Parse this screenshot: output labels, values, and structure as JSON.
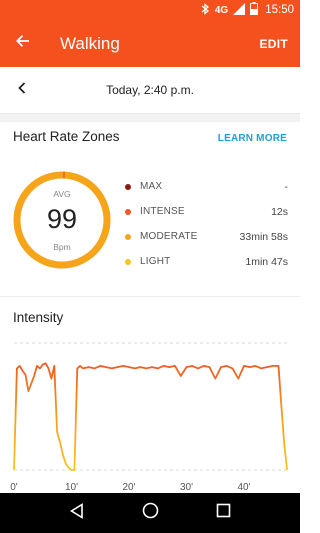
{
  "status": {
    "network": "4G",
    "time": "15:50",
    "icons": [
      "bluetooth-icon",
      "signal-icon",
      "battery-icon"
    ]
  },
  "app_bar": {
    "title": "Walking",
    "edit_label": "EDIT",
    "back_icon": "arrow-left-icon",
    "color": "#f4511e"
  },
  "date_bar": {
    "date": "Today, 2:40 p.m.",
    "prev_icon": "chevron-left-icon"
  },
  "heart_rate": {
    "title": "Heart Rate Zones",
    "learn_more": "LEARN MORE",
    "avg_label": "AVG",
    "avg_value": "99",
    "unit": "Bpm",
    "zones": [
      {
        "name": "MAX",
        "value": "-",
        "color": "#8b1a10"
      },
      {
        "name": "INTENSE",
        "value": "12s",
        "color": "#f05a24"
      },
      {
        "name": "MODERATE",
        "value": "33min 58s",
        "color": "#f6a51b"
      },
      {
        "name": "LIGHT",
        "value": "1min 47s",
        "color": "#f8c41f"
      }
    ]
  },
  "intensity": {
    "title": "Intensity"
  },
  "chart_data": {
    "type": "area",
    "title": "Intensity",
    "x_ticks": [
      "0'",
      "10'",
      "20'",
      "30'",
      "40'"
    ],
    "xlim": [
      0,
      48
    ],
    "x": [
      0,
      0.5,
      1,
      1.5,
      2,
      2.5,
      3,
      3.5,
      4,
      4.5,
      5,
      5.5,
      6,
      6.5,
      7,
      7.5,
      8,
      8.5,
      9,
      9.5,
      10,
      10.5,
      11,
      11.5,
      12,
      13,
      14,
      15,
      16,
      17,
      18,
      19,
      20,
      21,
      22,
      23,
      24,
      25,
      26,
      27,
      28,
      29,
      30,
      31,
      32,
      33,
      34,
      35,
      36,
      37,
      38,
      39,
      40,
      41,
      42,
      43,
      44,
      45,
      46,
      46.5,
      47,
      47.5
    ],
    "values": [
      0,
      0.8,
      0.82,
      0.78,
      0.75,
      0.62,
      0.68,
      0.74,
      0.82,
      0.8,
      0.83,
      0.84,
      0.8,
      0.72,
      0.82,
      0.3,
      0.22,
      0.12,
      0.05,
      0.02,
      0.0,
      0.0,
      0.8,
      0.82,
      0.8,
      0.81,
      0.8,
      0.82,
      0.81,
      0.8,
      0.81,
      0.82,
      0.81,
      0.8,
      0.81,
      0.8,
      0.81,
      0.8,
      0.82,
      0.81,
      0.82,
      0.74,
      0.81,
      0.82,
      0.8,
      0.82,
      0.81,
      0.72,
      0.81,
      0.82,
      0.8,
      0.72,
      0.82,
      0.81,
      0.82,
      0.8,
      0.81,
      0.82,
      0.82,
      0.5,
      0.2,
      0.0
    ],
    "ylim": [
      0,
      1
    ],
    "grid": true,
    "colors": [
      "#f05a24",
      "#f6a51b",
      "#f8c41f"
    ]
  }
}
